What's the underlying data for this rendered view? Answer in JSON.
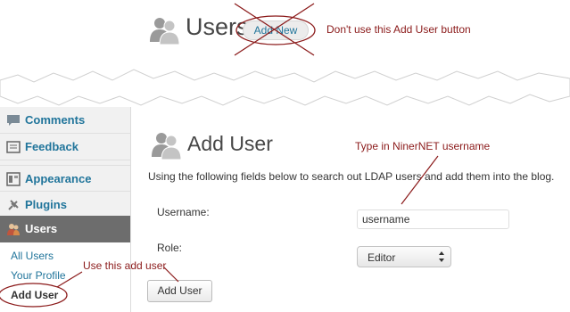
{
  "header": {
    "title": "Users",
    "add_new_label": "Add New",
    "add_new_note": "Don't use this Add User button"
  },
  "sidebar": {
    "items": [
      {
        "label": "Comments",
        "icon": "comments-icon"
      },
      {
        "label": "Feedback",
        "icon": "feedback-icon"
      },
      {
        "label": "Appearance",
        "icon": "appearance-icon"
      },
      {
        "label": "Plugins",
        "icon": "plugins-icon"
      },
      {
        "label": "Users",
        "icon": "users-icon",
        "active": true
      }
    ],
    "submenu": [
      {
        "label": "All Users"
      },
      {
        "label": "Your Profile"
      },
      {
        "label": "Add User",
        "current": true
      }
    ],
    "use_note": "Use this add user"
  },
  "main": {
    "title": "Add User",
    "username_note": "Type in NinerNET username",
    "description": "Using the following fields below to search out LDAP users and add them into the blog.",
    "username_label": "Username:",
    "username_value": "username",
    "role_label": "Role:",
    "role_value": "Editor",
    "submit_label": "Add User"
  },
  "colors": {
    "link": "#21759b",
    "annotation": "#8b1a1a",
    "active_menu": "#6d6d6d"
  }
}
